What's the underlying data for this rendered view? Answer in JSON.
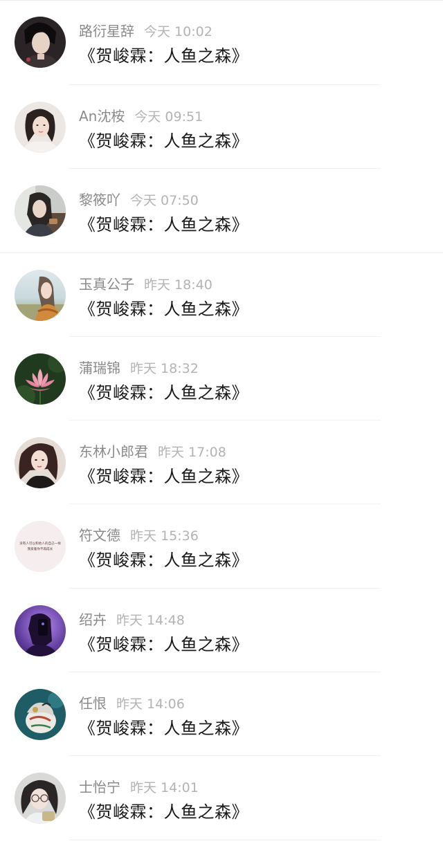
{
  "comments": [
    {
      "user": "路衍星辞",
      "time": "今天 10:02",
      "text": "《贺峻霖：人鱼之森》",
      "avatar": "avatar-dark-portrait"
    },
    {
      "user": "An沈桉",
      "time": "今天 09:51",
      "text": "《贺峻霖：人鱼之森》",
      "avatar": "avatar-woman-light"
    },
    {
      "user": "黎筱吖",
      "time": "今天 07:50",
      "text": "《贺峻霖：人鱼之森》",
      "avatar": "avatar-girl-cafe"
    },
    {
      "user": "玉真公子",
      "time": "昨天 18:40",
      "text": "《贺峻霖：人鱼之森》",
      "avatar": "avatar-field-portrait"
    },
    {
      "user": "蒲瑞锦",
      "time": "昨天 18:32",
      "text": "《贺峻霖：人鱼之森》",
      "avatar": "avatar-lotus"
    },
    {
      "user": "东林小郎君",
      "time": "昨天 17:08",
      "text": "《贺峻霖：人鱼之森》",
      "avatar": "avatar-woman-scarf"
    },
    {
      "user": "符文德",
      "time": "昨天 15:36",
      "text": "《贺峻霖：人鱼之森》",
      "avatar": "avatar-text-quote"
    },
    {
      "user": "绍卉",
      "time": "昨天 14:48",
      "text": "《贺峻霖：人鱼之森》",
      "avatar": "avatar-purple-mirror"
    },
    {
      "user": "任恨",
      "time": "昨天 14:06",
      "text": "《贺峻霖：人鱼之森》",
      "avatar": "avatar-porcelain-figure"
    },
    {
      "user": "士怡宁",
      "time": "昨天 14:01",
      "text": "《贺峻霖：人鱼之森》",
      "avatar": "avatar-girl-glasses"
    }
  ],
  "avatar_text": "没有人可以和他人的自己一样 我爱着你不再成长",
  "colors": {
    "username": "#8a8a8a",
    "timestamp": "#b3b3b3",
    "comment": "#1a1a1a",
    "divider": "#f1f1f1"
  }
}
